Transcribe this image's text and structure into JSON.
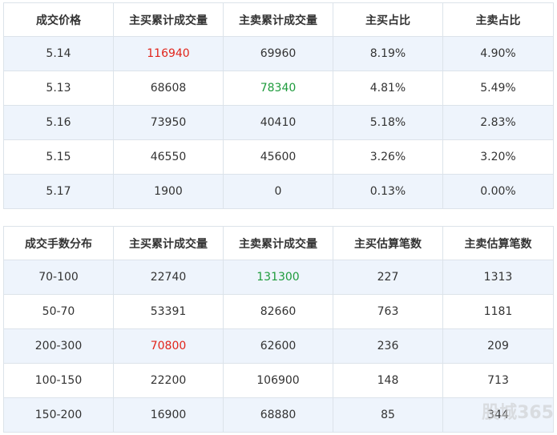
{
  "table1": {
    "headers": [
      "成交价格",
      "主买累计成交量",
      "主卖累计成交量",
      "主买占比",
      "主卖占比"
    ],
    "rows": [
      [
        "5.14",
        "116940",
        "69960",
        "8.19%",
        "4.90%"
      ],
      [
        "5.13",
        "68608",
        "78340",
        "4.81%",
        "5.49%"
      ],
      [
        "5.16",
        "73950",
        "40410",
        "5.18%",
        "2.83%"
      ],
      [
        "5.15",
        "46550",
        "45600",
        "3.26%",
        "3.20%"
      ],
      [
        "5.17",
        "1900",
        "0",
        "0.13%",
        "0.00%"
      ]
    ]
  },
  "table2": {
    "headers": [
      "成交手数分布",
      "主买累计成交量",
      "主卖累计成交量",
      "主买估算笔数",
      "主卖估算笔数"
    ],
    "rows": [
      [
        "70-100",
        "22740",
        "131300",
        "227",
        "1313"
      ],
      [
        "50-70",
        "53391",
        "82660",
        "763",
        "1181"
      ],
      [
        "200-300",
        "70800",
        "62600",
        "236",
        "209"
      ],
      [
        "100-150",
        "22200",
        "106900",
        "148",
        "713"
      ],
      [
        "150-200",
        "16900",
        "68880",
        "85",
        "344"
      ]
    ]
  },
  "colors": {
    "highlight_red": "#e1251b",
    "highlight_green": "#1e9b3c",
    "row_alt": "#eef4fc",
    "border": "#dce3ea"
  },
  "watermark": "股城365"
}
